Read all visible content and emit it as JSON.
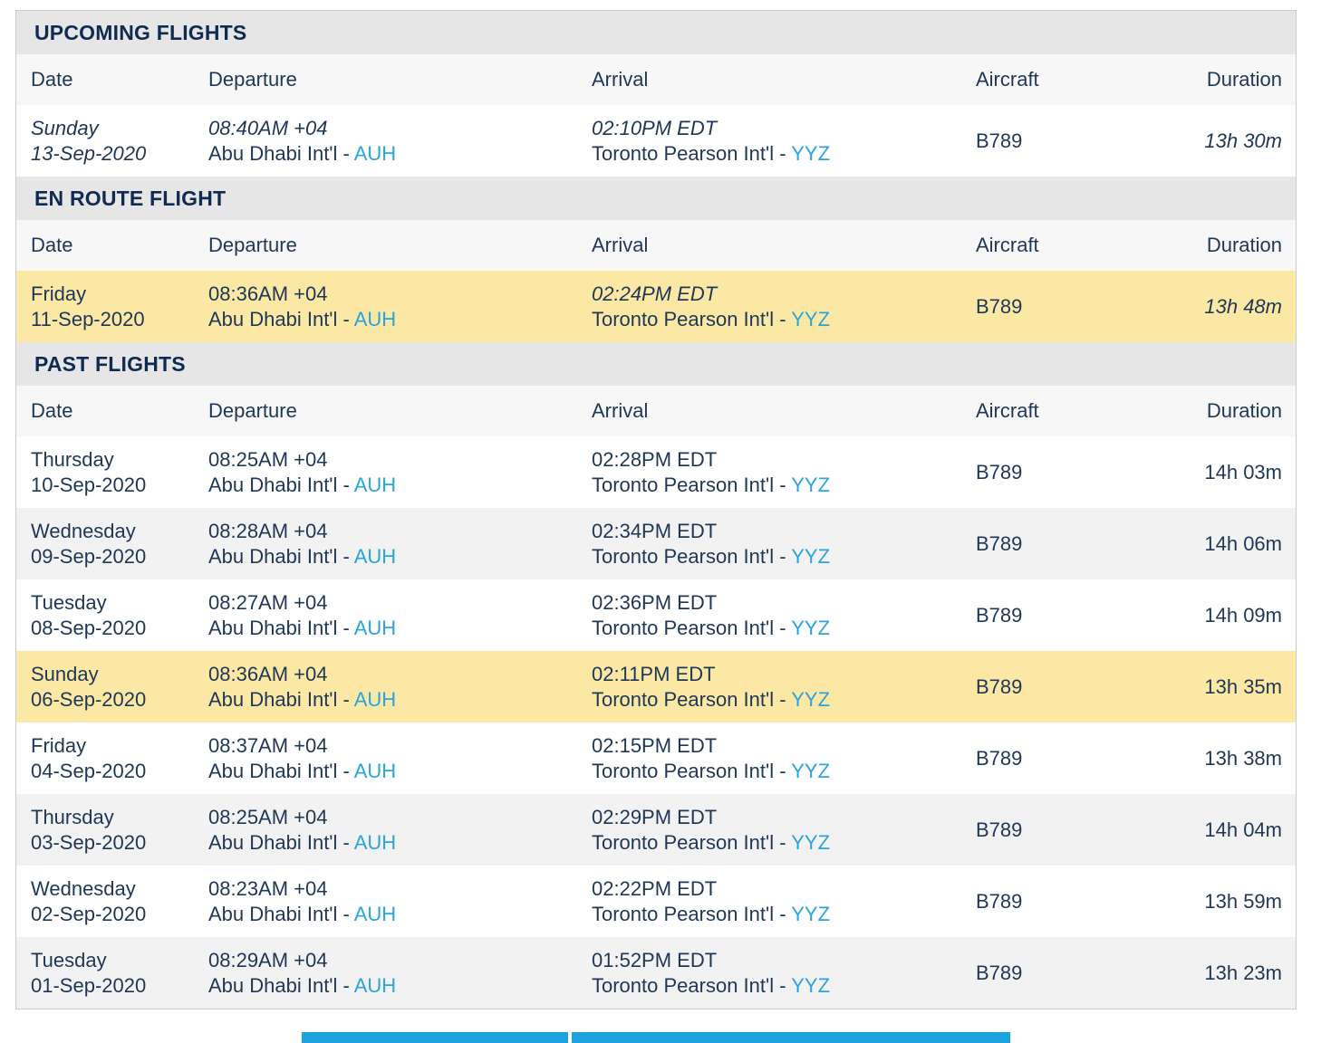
{
  "columns": {
    "date": "Date",
    "departure": "Departure",
    "arrival": "Arrival",
    "aircraft": "Aircraft",
    "duration": "Duration"
  },
  "upcoming": {
    "title": "UPCOMING FLIGHTS",
    "rows": [
      {
        "day": "Sunday",
        "date": "13-Sep-2020",
        "dep_time": "08:40AM +04",
        "dep_airport": "Abu Dhabi Int'l - ",
        "dep_code": "AUH",
        "arr_time": "02:10PM EDT",
        "arr_airport": "Toronto Pearson Int'l - ",
        "arr_code": "YYZ",
        "aircraft": "B789",
        "duration": "13h 30m"
      }
    ]
  },
  "enroute": {
    "title": "EN ROUTE FLIGHT",
    "rows": [
      {
        "day": "Friday",
        "date": "11-Sep-2020",
        "dep_time": "08:36AM +04",
        "dep_airport": "Abu Dhabi Int'l - ",
        "dep_code": "AUH",
        "arr_time": "02:24PM EDT",
        "arr_airport": "Toronto Pearson Int'l - ",
        "arr_code": "YYZ",
        "aircraft": "B789",
        "duration": "13h 48m"
      }
    ]
  },
  "past": {
    "title": "PAST FLIGHTS",
    "rows": [
      {
        "day": "Thursday",
        "date": "10-Sep-2020",
        "dep_time": "08:25AM +04",
        "dep_airport": "Abu Dhabi Int'l - ",
        "dep_code": "AUH",
        "arr_time": "02:28PM EDT",
        "arr_airport": "Toronto Pearson Int'l - ",
        "arr_code": "YYZ",
        "aircraft": "B789",
        "duration": "14h 03m"
      },
      {
        "day": "Wednesday",
        "date": "09-Sep-2020",
        "dep_time": "08:28AM +04",
        "dep_airport": "Abu Dhabi Int'l - ",
        "dep_code": "AUH",
        "arr_time": "02:34PM EDT",
        "arr_airport": "Toronto Pearson Int'l - ",
        "arr_code": "YYZ",
        "aircraft": "B789",
        "duration": "14h 06m"
      },
      {
        "day": "Tuesday",
        "date": "08-Sep-2020",
        "dep_time": "08:27AM +04",
        "dep_airport": "Abu Dhabi Int'l - ",
        "dep_code": "AUH",
        "arr_time": "02:36PM EDT",
        "arr_airport": "Toronto Pearson Int'l - ",
        "arr_code": "YYZ",
        "aircraft": "B789",
        "duration": "14h 09m"
      },
      {
        "day": "Sunday",
        "date": "06-Sep-2020",
        "dep_time": "08:36AM +04",
        "dep_airport": "Abu Dhabi Int'l - ",
        "dep_code": "AUH",
        "arr_time": "02:11PM EDT",
        "arr_airport": "Toronto Pearson Int'l - ",
        "arr_code": "YYZ",
        "aircraft": "B789",
        "duration": "13h 35m"
      },
      {
        "day": "Friday",
        "date": "04-Sep-2020",
        "dep_time": "08:37AM +04",
        "dep_airport": "Abu Dhabi Int'l - ",
        "dep_code": "AUH",
        "arr_time": "02:15PM EDT",
        "arr_airport": "Toronto Pearson Int'l - ",
        "arr_code": "YYZ",
        "aircraft": "B789",
        "duration": "13h 38m"
      },
      {
        "day": "Thursday",
        "date": "03-Sep-2020",
        "dep_time": "08:25AM +04",
        "dep_airport": "Abu Dhabi Int'l - ",
        "dep_code": "AUH",
        "arr_time": "02:29PM EDT",
        "arr_airport": "Toronto Pearson Int'l - ",
        "arr_code": "YYZ",
        "aircraft": "B789",
        "duration": "14h 04m"
      },
      {
        "day": "Wednesday",
        "date": "02-Sep-2020",
        "dep_time": "08:23AM +04",
        "dep_airport": "Abu Dhabi Int'l - ",
        "dep_code": "AUH",
        "arr_time": "02:22PM EDT",
        "arr_airport": "Toronto Pearson Int'l - ",
        "arr_code": "YYZ",
        "aircraft": "B789",
        "duration": "13h 59m"
      },
      {
        "day": "Tuesday",
        "date": "01-Sep-2020",
        "dep_time": "08:29AM +04",
        "dep_airport": "Abu Dhabi Int'l - ",
        "dep_code": "AUH",
        "arr_time": "01:52PM EDT",
        "arr_airport": "Toronto Pearson Int'l - ",
        "arr_code": "YYZ",
        "aircraft": "B789",
        "duration": "13h 23m"
      }
    ]
  },
  "colors": {
    "highlight": "#fbe8a4",
    "link": "#2ba3dc",
    "header_text": "#0f2b52",
    "pager": "#1aa3df"
  }
}
